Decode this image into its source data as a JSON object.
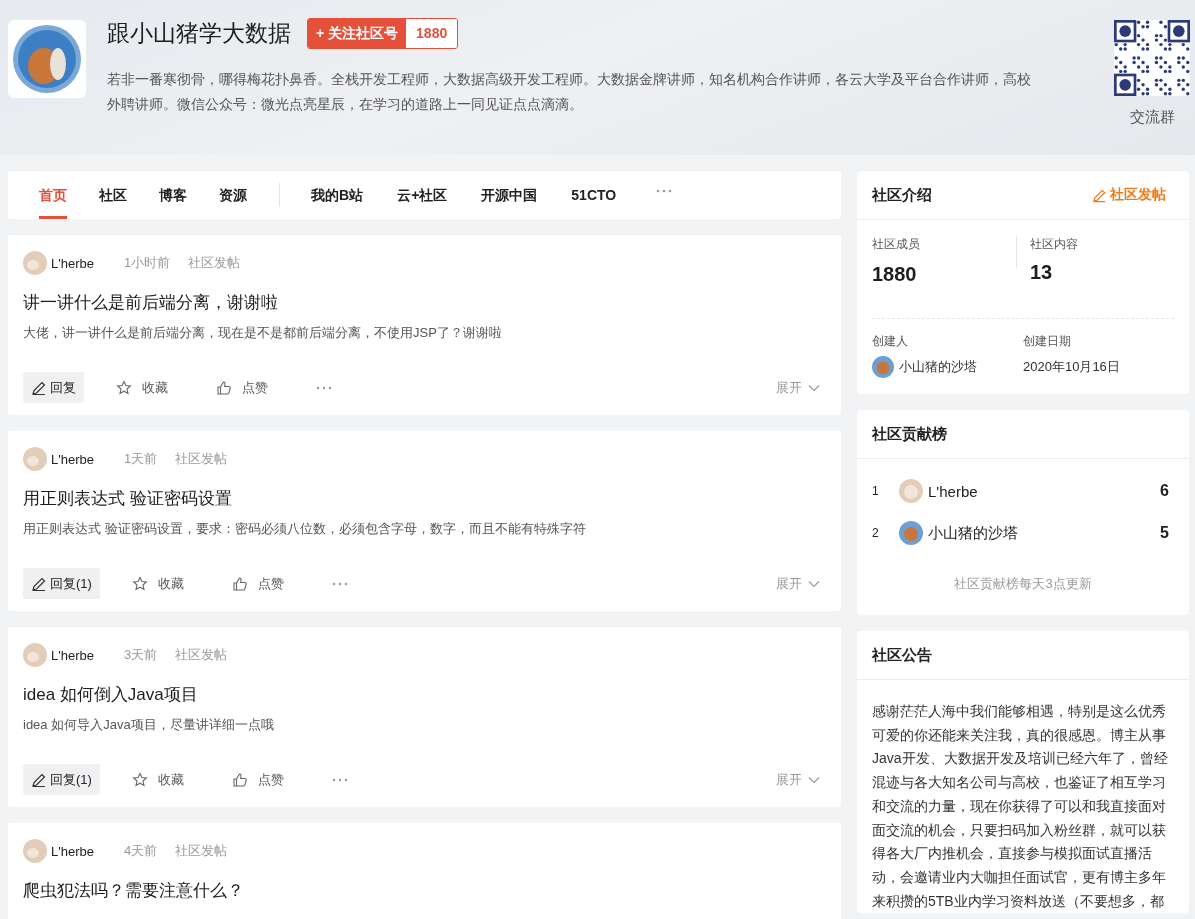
{
  "header": {
    "title": "跟小山猪学大数据",
    "follow_button": "+ 关注社区号",
    "follower_count": "1880",
    "description": "若非一番寒彻骨，哪得梅花扑鼻香。全栈开发工程师，大数据高级开发工程师。大数据金牌讲师，知名机构合作讲师，各云大学及平台合作讲师，高校外聘讲师。微信公众号：微光点亮星辰，在学习的道路上一同见证点点滴滴。",
    "qr_label": "交流群"
  },
  "nav": {
    "tabs": [
      {
        "label": "首页",
        "selected": true
      },
      {
        "label": "社区",
        "selected": false
      },
      {
        "label": "博客",
        "selected": false
      },
      {
        "label": "资源",
        "selected": false
      }
    ],
    "links": [
      "我的B站",
      "云+社区",
      "开源中国",
      "51CTO"
    ]
  },
  "posts": [
    {
      "author": "L'herbe",
      "time": "1小时前",
      "source": "社区发帖",
      "title": "讲一讲什么是前后端分离，谢谢啦",
      "excerpt": "大佬，讲一讲什么是前后端分离，现在是不是都前后端分离，不使用JSP了？谢谢啦",
      "reply": "回复",
      "collect": "收藏",
      "like": "点赞",
      "expand": "展开"
    },
    {
      "author": "L'herbe",
      "time": "1天前",
      "source": "社区发帖",
      "title": "用正则表达式 验证密码设置",
      "excerpt": "用正则表达式 验证密码设置，要求：密码必须八位数，必须包含字母，数字，而且不能有特殊字符",
      "reply": "回复(1)",
      "collect": "收藏",
      "like": "点赞",
      "expand": "展开"
    },
    {
      "author": "L'herbe",
      "time": "3天前",
      "source": "社区发帖",
      "title": "idea 如何倒入Java项目",
      "excerpt": "idea 如何导入Java项目，尽量讲详细一点哦",
      "reply": "回复(1)",
      "collect": "收藏",
      "like": "点赞",
      "expand": "展开"
    },
    {
      "author": "L'herbe",
      "time": "4天前",
      "source": "社区发帖",
      "title": "爬虫犯法吗？需要注意什么？"
    }
  ],
  "intro": {
    "title": "社区介绍",
    "post_button": "社区发帖",
    "stats": [
      {
        "label": "社区成员",
        "value": "1880"
      },
      {
        "label": "社区内容",
        "value": "13"
      }
    ],
    "creator_label": "创建人",
    "creator": "小山猪的沙塔",
    "date_label": "创建日期",
    "date": "2020年10月16日"
  },
  "ranking": {
    "title": "社区贡献榜",
    "rows": [
      {
        "rank": "1",
        "name": "L'herbe",
        "score": "6"
      },
      {
        "rank": "2",
        "name": "小山猪的沙塔",
        "score": "5"
      }
    ],
    "note": "社区贡献榜每天3点更新"
  },
  "notice": {
    "title": "社区公告",
    "text": "感谢茫茫人海中我们能够相遇，特别是这么优秀可爱的你还能来关注我，真的很感恩。博主从事Java开发、大数据开发及培训已经六年了，曾经混迹与各大知名公司与高校，也鉴证了相互学习和交流的力量，现在你获得了可以和我直接面对面交流的机会，只要扫码加入粉丝群，就可以获得各大厂内推机会，直接参与模拟面试直播活动，会邀请业内大咖担任面试官，更有博主多年来积攒的5TB业内学习资料放送（不要想多，都"
  }
}
